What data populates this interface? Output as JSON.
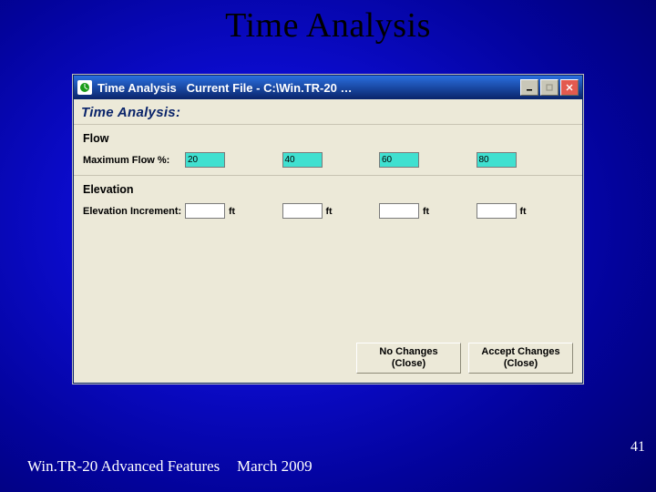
{
  "slide": {
    "title": "Time Analysis",
    "footer_left": "Win.TR-20 Advanced Features",
    "footer_mid": "March 2009",
    "page_number": "41"
  },
  "window": {
    "title_prefix": "Time Analysis",
    "title_suffix": "Current File - C:\\Win.TR-20 …",
    "subtitle": "Time Analysis:",
    "sections": {
      "flow": {
        "heading": "Flow",
        "label": "Maximum Flow %:",
        "values": [
          "20",
          "40",
          "60",
          "80"
        ]
      },
      "elevation": {
        "heading": "Elevation",
        "label": "Elevation Increment:",
        "unit": "ft",
        "values": [
          "",
          "",
          "",
          ""
        ]
      }
    },
    "buttons": {
      "no_changes_l1": "No Changes",
      "no_changes_l2": "(Close)",
      "accept_l1": "Accept Changes",
      "accept_l2": "(Close)"
    }
  }
}
